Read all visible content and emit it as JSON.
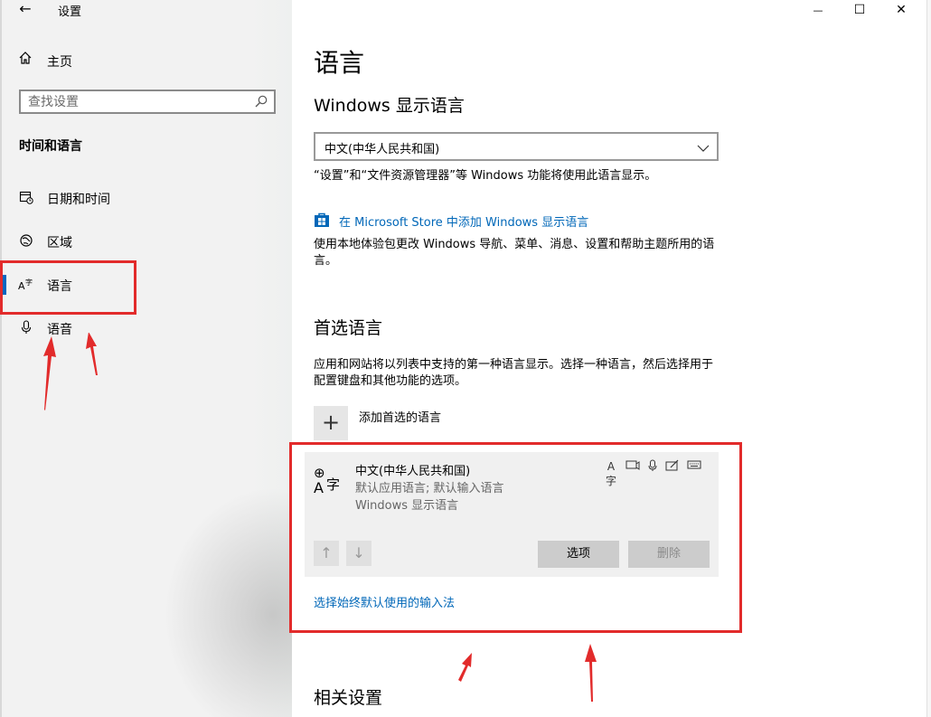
{
  "window": {
    "back_glyph": "←",
    "title": "设置",
    "minimize_glyph": "—",
    "maximize_glyph": "☐",
    "close_glyph": "✕"
  },
  "sidebar": {
    "home_icon": "home-icon",
    "home_label": "主页",
    "search_placeholder": "查找设置",
    "section_heading": "时间和语言",
    "items": [
      {
        "label": "日期和时间",
        "icon": "date-time-icon",
        "active": false
      },
      {
        "label": "区域",
        "icon": "region-icon",
        "active": false
      },
      {
        "label": "语言",
        "icon": "language-icon",
        "active": true
      },
      {
        "label": "语音",
        "icon": "microphone-icon",
        "active": false
      }
    ]
  },
  "main": {
    "title": "语言",
    "display_language_heading": "Windows 显示语言",
    "display_language_value": "中文(中华人民共和国)",
    "display_language_desc": "“设置”和“文件资源管理器”等 Windows 功能将使用此语言显示。",
    "store_link": "在 Microsoft Store 中添加 Windows 显示语言",
    "store_desc": "使用本地体验包更改 Windows 导航、菜单、消息、设置和帮助主题所用的语言。",
    "preferred_heading": "首选语言",
    "preferred_desc": "应用和网站将以列表中支持的第一种语言显示。选择一种语言，然后选择用于配置键盘和其他功能的选项。",
    "add_language_label": "添加首选的语言",
    "language_card": {
      "name": "中文(中华人民共和国)",
      "info_line1": "默认应用语言; 默认输入语言",
      "info_line2": "Windows 显示语言",
      "feature_icons": [
        "display-language-icon",
        "speech-icon",
        "microphone-icon",
        "handwriting-icon",
        "keyboard-icon"
      ],
      "options_button": "选项",
      "remove_button": "删除"
    },
    "input_method_link": "选择始终默认使用的输入法",
    "related_heading": "相关设置"
  },
  "colors": {
    "accent": "#0067c0",
    "link": "#0067b8",
    "annotation_red": "#e22b2b",
    "sidebar_bg": "#f2f2f2"
  }
}
